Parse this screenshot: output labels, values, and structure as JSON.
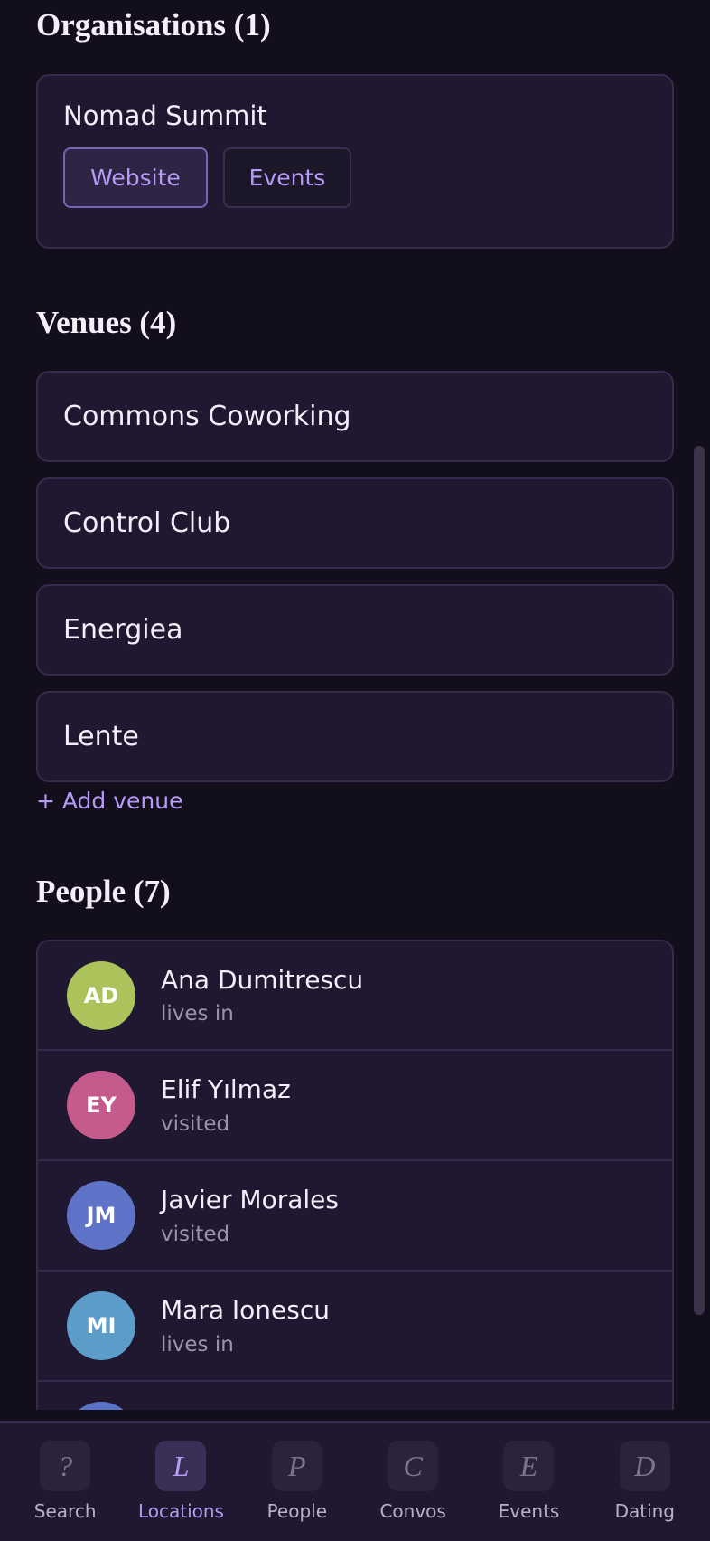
{
  "organisations": {
    "title": "Organisations (1)",
    "items": [
      {
        "name": "Nomad Summit",
        "website_label": "Website",
        "events_label": "Events"
      }
    ]
  },
  "venues": {
    "title": "Venues (4)",
    "items": [
      {
        "name": "Commons Coworking"
      },
      {
        "name": "Control Club"
      },
      {
        "name": "Energiea"
      },
      {
        "name": "Lente"
      }
    ],
    "add_label": "+ Add venue"
  },
  "people": {
    "title": "People (7)",
    "items": [
      {
        "initials": "AD",
        "name": "Ana Dumitrescu",
        "relation": "lives in",
        "color": "#abc35a"
      },
      {
        "initials": "EY",
        "name": "Elif Yılmaz",
        "relation": "visited",
        "color": "#c45b8c"
      },
      {
        "initials": "JM",
        "name": "Javier Morales",
        "relation": "visited",
        "color": "#5f73c8"
      },
      {
        "initials": "MI",
        "name": "Mara Ionescu",
        "relation": "lives in",
        "color": "#5b9cc9"
      }
    ]
  },
  "nav": {
    "items": [
      {
        "icon": "?",
        "label": "Search",
        "active": false
      },
      {
        "icon": "L",
        "label": "Locations",
        "active": true
      },
      {
        "icon": "P",
        "label": "People",
        "active": false
      },
      {
        "icon": "C",
        "label": "Convos",
        "active": false
      },
      {
        "icon": "E",
        "label": "Events",
        "active": false
      },
      {
        "icon": "D",
        "label": "Dating",
        "active": false
      }
    ]
  },
  "colors": {
    "background": "#130e1c",
    "card": "#1f1830",
    "accent": "#b79af7"
  }
}
